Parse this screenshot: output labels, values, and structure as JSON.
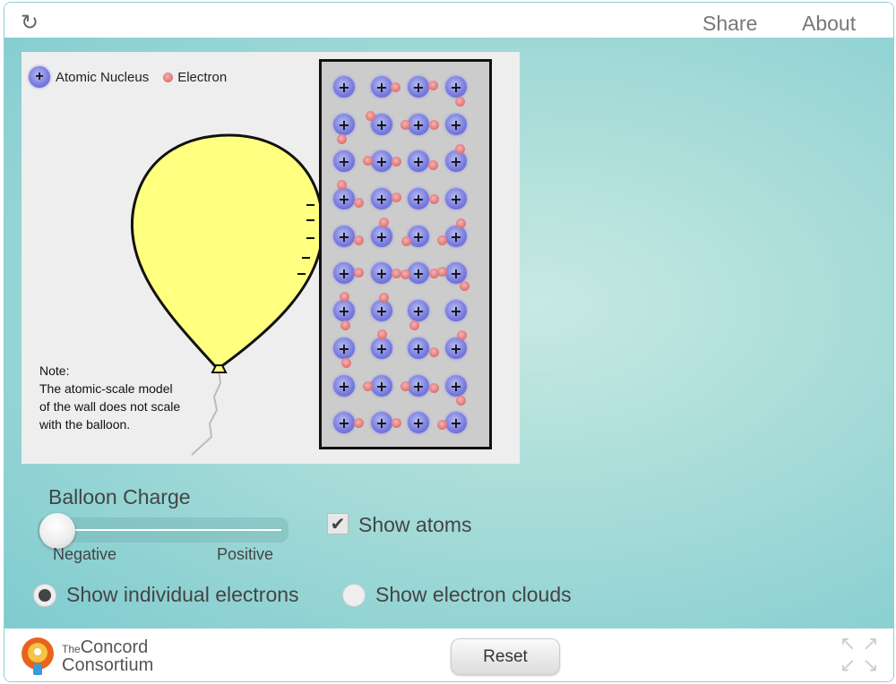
{
  "topbar": {
    "reload_icon": "reload-icon",
    "share": "Share",
    "about": "About"
  },
  "sim": {
    "legend": {
      "nucleus_symbol": "+",
      "nucleus_label": "Atomic Nucleus",
      "electron_symbol": "-",
      "electron_label": "Electron"
    },
    "note": [
      "Note:",
      "The atomic-scale model",
      "of the wall does not scale",
      "with the balloon."
    ],
    "balloon_color": "#ffff80",
    "wall": {
      "rows": 10,
      "cols": 4
    }
  },
  "controls": {
    "charge_title": "Balloon Charge",
    "charge_min_label": "Negative",
    "charge_max_label": "Positive",
    "charge_fraction": 0,
    "show_atoms_label": "Show atoms",
    "show_atoms_checked": true,
    "radio_individual": "Show individual electrons",
    "radio_clouds": "Show electron clouds",
    "selected_radio": "individual"
  },
  "bottombar": {
    "logo_small": "The",
    "logo_line1": "Concord",
    "logo_line2": "Consortium",
    "reset": "Reset",
    "fullscreen_icon": "fullscreen-icon"
  },
  "colors": {
    "accent": "#7fcbd0",
    "nucleus": "#7b7fe0",
    "electron": "#e07070"
  }
}
